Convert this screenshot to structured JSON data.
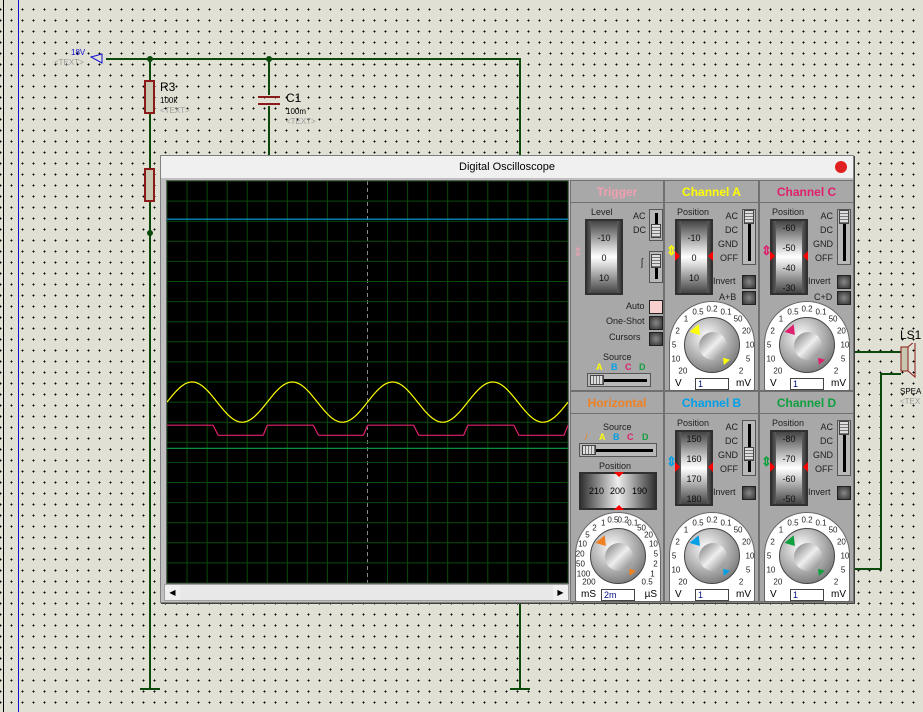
{
  "schematic": {
    "supply": {
      "voltage": "18V",
      "text": "<TEXT>"
    },
    "r3": {
      "name": "R3",
      "value": "100k",
      "text": "<TEXT>"
    },
    "c1": {
      "name": "C1",
      "value": "100m",
      "text": "<TEXT>"
    },
    "speaker": {
      "name": "LS1",
      "type": "SPEA",
      "text": "<TEX"
    }
  },
  "scope": {
    "title": "Digital Oscilloscope",
    "colors": {
      "a": "#ffff00",
      "b": "#00a0e8",
      "c": "#e0206e",
      "d": "#10a040",
      "trigger": "#f0a0b0",
      "horizontal": "#f08020"
    },
    "trigger": {
      "title": "Trigger",
      "level_label": "Level",
      "level_ticks": [
        "-10",
        "0",
        "10"
      ],
      "ac": "AC",
      "dc": "DC",
      "auto": "Auto",
      "oneshot": "One-Shot",
      "cursors": "Cursors",
      "source_label": "Source",
      "sources": [
        "A",
        "B",
        "C",
        "D"
      ],
      "auto_on": true
    },
    "channels": [
      {
        "key": "a",
        "title": "Channel A",
        "pos_label": "Position",
        "ticks": [
          "-10",
          "0",
          "10"
        ],
        "modes": [
          "AC",
          "DC",
          "GND",
          "OFF"
        ],
        "invert": "Invert",
        "combine": "A+B",
        "value": "1",
        "unit_left": "V",
        "unit_right": "mV",
        "mode_selected": "AC"
      },
      {
        "key": "c",
        "title": "Channel C",
        "pos_label": "Position",
        "ticks": [
          "-60",
          "-50",
          "-40",
          "-30"
        ],
        "modes": [
          "AC",
          "DC",
          "GND",
          "OFF"
        ],
        "invert": "Invert",
        "combine": "C+D",
        "value": "1",
        "unit_left": "V",
        "unit_right": "mV",
        "mode_selected": "AC"
      },
      {
        "key": "b",
        "title": "Channel B",
        "pos_label": "Position",
        "ticks": [
          "150",
          "160",
          "170",
          "180"
        ],
        "modes": [
          "AC",
          "DC",
          "GND",
          "OFF"
        ],
        "invert": "Invert",
        "value": "1",
        "unit_left": "V",
        "unit_right": "mV",
        "mode_selected": "GND"
      },
      {
        "key": "d",
        "title": "Channel D",
        "pos_label": "Position",
        "ticks": [
          "-80",
          "-70",
          "-60",
          "-50"
        ],
        "modes": [
          "AC",
          "DC",
          "GND",
          "OFF"
        ],
        "invert": "Invert",
        "value": "1",
        "unit_left": "V",
        "unit_right": "mV",
        "mode_selected": "AC"
      }
    ],
    "volt_scale": [
      "20",
      "10",
      "5",
      "2",
      "1",
      "0.5",
      "0.2",
      "0.1",
      "50",
      "20",
      "10",
      "5",
      "2"
    ],
    "horizontal": {
      "title": "Horizontal",
      "source_label": "Source",
      "sources": [
        "/",
        "A",
        "B",
        "C",
        "D"
      ],
      "pos_label": "Position",
      "pos_ticks": [
        "210",
        "200",
        "190"
      ],
      "value": "2m",
      "unit_left": "mS",
      "unit_right": "µS",
      "time_scale": [
        "200",
        "100",
        "50",
        "20",
        "10",
        "5",
        "2",
        "1",
        "0.5",
        "0.2",
        "0.1",
        "50",
        "20",
        "10",
        "5",
        "2",
        "1",
        "0.5"
      ]
    }
  },
  "chart_data": {
    "type": "line",
    "grid": true,
    "series": [
      {
        "key": "a",
        "shape": "sine",
        "periods_visible": 4,
        "level_div": -1,
        "amplitude_div": 1
      },
      {
        "key": "c",
        "shape": "square",
        "periods_visible": 4,
        "high_div": -2.15,
        "low_div": -2.65
      },
      {
        "key": "d",
        "shape": "flat",
        "level_div": -3.3
      },
      {
        "key": "b",
        "shape": "flat",
        "level_div": 8.1
      }
    ],
    "divisions": {
      "x": 20,
      "y": 20
    }
  }
}
